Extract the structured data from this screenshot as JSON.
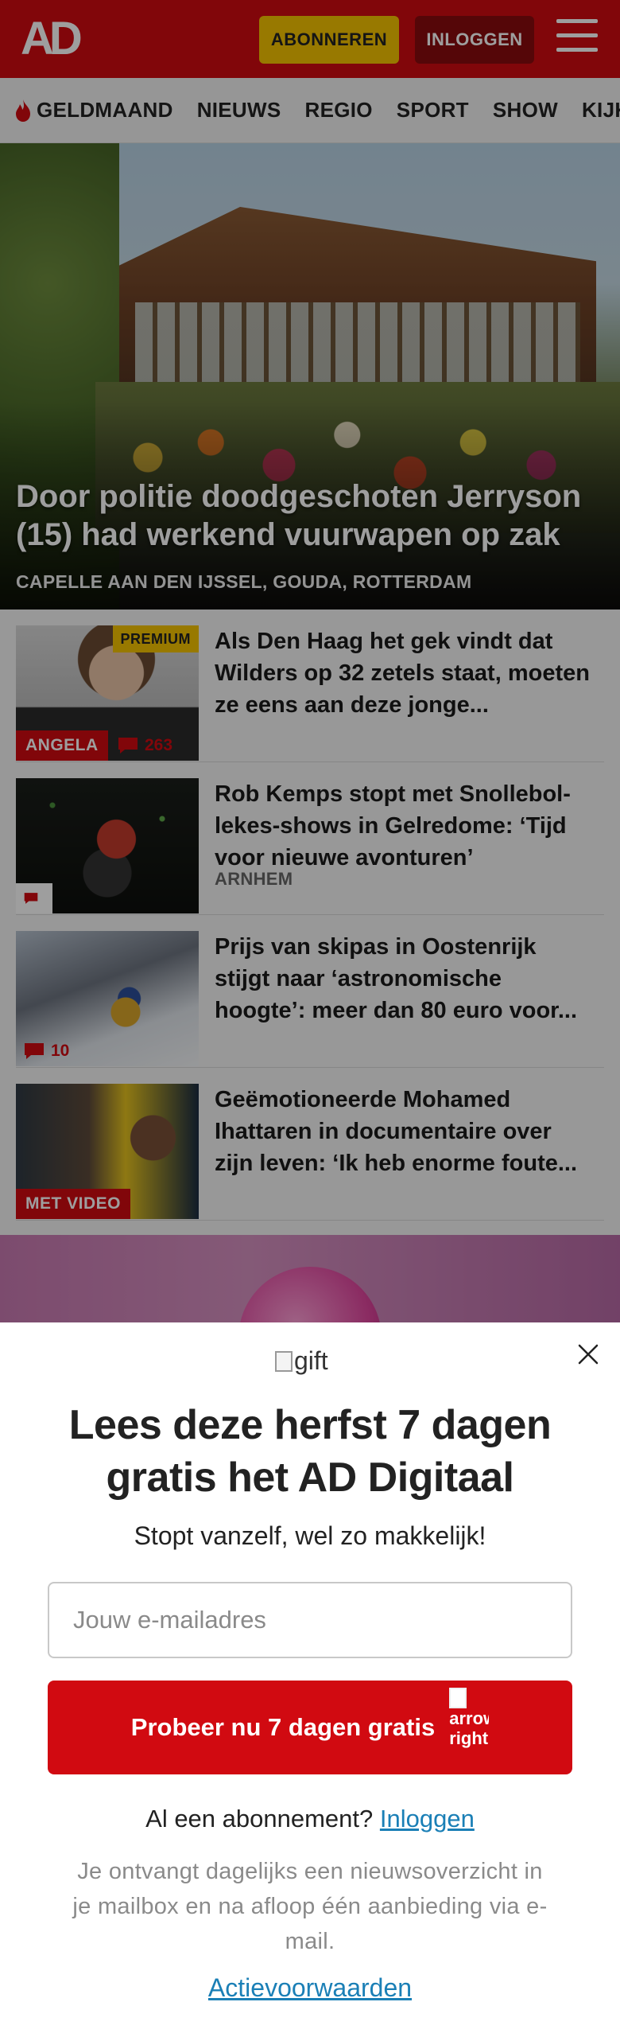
{
  "header": {
    "logo": "AD",
    "subscribe_label": "ABONNEREN",
    "login_label": "INLOGGEN"
  },
  "nav": {
    "items": [
      "GELDMAAND",
      "NIEUWS",
      "REGIO",
      "SPORT",
      "SHOW",
      "KIJK"
    ]
  },
  "hero": {
    "title": "Door politie doodgeschoten Jerryson (15) had werkend vuurwapen op zak",
    "location": "CAPELLE AAN DEN IJSSEL, GOUDA, ROTTERDAM"
  },
  "articles": [
    {
      "title": "Als Den Haag het gek vindt dat Wilders op 32 zetels staat, moeten ze eens aan deze jonge...",
      "premium": "PREMIUM",
      "badge": "ANGELA",
      "comments": "263"
    },
    {
      "title": "Rob Kemps stopt met Snollebol-lekes-shows in Gelredome: ‘Tijd voor nieuwe avonturen’",
      "location": "ARNHEM"
    },
    {
      "title": "Prijs van skipas in Oostenrijk stijgt naar ‘astronomische hoogte’: meer dan 80 euro voor...",
      "comments": "10"
    },
    {
      "title": "Geëmotioneerde Mohamed Ihattaren in documentaire over zijn leven: ‘Ik heb enorme foute...",
      "badge": "MET VIDEO"
    }
  ],
  "modal": {
    "gift_alt": "gift",
    "title": "Lees deze herfst 7 dagen gratis het AD Digitaal",
    "subtitle": "Stopt vanzelf, wel zo makkelijk!",
    "email_placeholder": "Jouw e-mailadres",
    "cta_label": "Probeer nu 7 dagen gratis",
    "cta_icon_alt": "arrow right",
    "subscribed_question": "Al een abonnement?",
    "login_link": "Inloggen",
    "info": "Je ontvangt dagelijks een nieuwsoverzicht in je mailbox en na afloop één aanbieding via e-mail.",
    "terms": "Actievoorwaarden"
  },
  "colors": {
    "brand_red": "#d10a11",
    "premium_yellow": "#f5c400",
    "link_blue": "#1a7fb6"
  }
}
